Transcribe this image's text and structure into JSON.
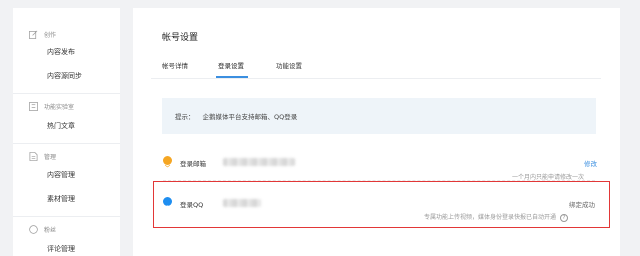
{
  "sidebar": {
    "sections": [
      {
        "title": "创作",
        "icon": "edit-icon",
        "items": [
          "内容发布",
          "内容源同步"
        ]
      },
      {
        "title": "功能实验室",
        "icon": "lab-icon",
        "items": [
          "热门文章"
        ]
      },
      {
        "title": "管理",
        "icon": "document-icon",
        "items": [
          "内容管理",
          "素材管理"
        ]
      },
      {
        "title": "粉丝",
        "icon": "fans-icon",
        "items": [
          "评论管理"
        ]
      }
    ]
  },
  "main": {
    "title": "帐号设置",
    "tabs": [
      "帐号详情",
      "登录设置",
      "功能设置"
    ],
    "active_tab": "登录设置",
    "tip": {
      "label": "提示：",
      "text": "企鹅媒体平台支持邮箱、QQ登录"
    },
    "email_row": {
      "label": "登录邮箱",
      "action": "修改",
      "note": "一个月内只能申请修改一次"
    },
    "qq_row": {
      "label": "登录QQ",
      "status": "绑定成功",
      "note": "专属功能上传视频，媒体身份登录快报已自动开通",
      "help": "?"
    }
  },
  "colors": {
    "accent": "#3b8fe0",
    "highlight": "#e23737",
    "email_icon": "#f5a623",
    "qq_icon": "#1e8ef0"
  }
}
